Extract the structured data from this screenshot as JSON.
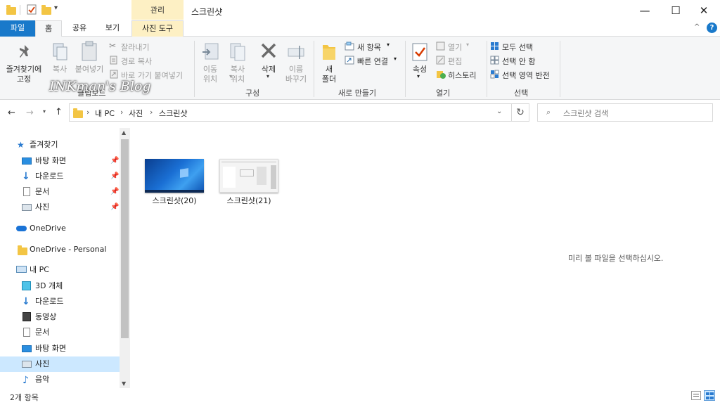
{
  "title_bar": {
    "context_tab": "관리",
    "window_title": "스크린샷",
    "minimize": "—",
    "maximize": "☐",
    "close": "✕"
  },
  "ribbon_tabs": [
    "파일",
    "홈",
    "공유",
    "보기",
    "사진 도구"
  ],
  "ribbon": {
    "clipboard": {
      "pin_label_1": "즐겨찾기에",
      "pin_label_2": "고정",
      "copy": "복사",
      "paste": "붙여넣기",
      "cut": "잘라내기",
      "copy_path": "경로 복사",
      "paste_shortcut": "바로 가기 붙여넣기",
      "group": "클립보드"
    },
    "organize": {
      "move_to_1": "이동",
      "move_to_2": "위치",
      "copy_to_1": "복사",
      "copy_to_2": "위치",
      "delete": "삭제",
      "rename_1": "이름",
      "rename_2": "바꾸기",
      "group": "구성"
    },
    "new": {
      "new_folder_1": "새",
      "new_folder_2": "폴더",
      "new_item": "새 항목",
      "easy_access": "빠른 연결",
      "group": "새로 만들기"
    },
    "open": {
      "properties": "속성",
      "open": "열기",
      "edit": "편집",
      "history": "히스토리",
      "group": "열기"
    },
    "select": {
      "select_all": "모두 선택",
      "select_none": "선택 안 함",
      "invert": "선택 영역 반전",
      "group": "선택"
    }
  },
  "watermark": "INKman's Blog",
  "address": {
    "crumbs": [
      "내 PC",
      "사진",
      "스크린샷"
    ],
    "search_placeholder": "스크린샷 검색"
  },
  "nav": {
    "quick_access": "즐겨찾기",
    "quick_items": [
      "바탕 화면",
      "다운로드",
      "문서",
      "사진"
    ],
    "onedrive": "OneDrive",
    "onedrive_personal": "OneDrive - Personal",
    "this_pc": "내 PC",
    "pc_items": [
      "3D 개체",
      "다운로드",
      "동영상",
      "문서",
      "바탕 화면",
      "사진",
      "음악"
    ]
  },
  "files": [
    {
      "name": "스크린샷(20)"
    },
    {
      "name": "스크린샷(21)"
    }
  ],
  "preview_message": "미리 볼 파일을 선택하십시오.",
  "status": {
    "count": "2개 항목"
  },
  "colors": {
    "accent": "#1979ca",
    "context": "#fdf0c4",
    "selected": "#cce8ff"
  }
}
